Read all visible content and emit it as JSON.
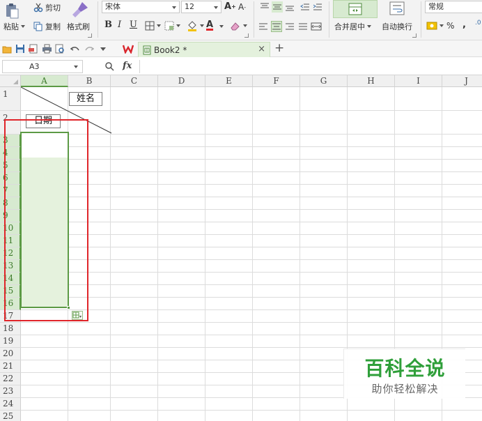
{
  "ribbon": {
    "clipboard": {
      "cut": "剪切",
      "paste": "粘贴",
      "copy": "复制",
      "format_painter": "格式刷"
    },
    "font": {
      "name": "宋体",
      "size": "12",
      "bold": "B",
      "italic": "I",
      "underline": "U",
      "grow": "A",
      "shrink": "A",
      "font_color_glyph": "A"
    },
    "alignment": {
      "merge_center": "合并居中",
      "wrap_text": "自动换行"
    },
    "number": {
      "format": "常规",
      "percent": "%",
      "comma": ","
    }
  },
  "quick_access": {
    "document_tab": "Book2 *",
    "tab_close": "×",
    "new_tab": "+"
  },
  "formula_bar": {
    "name_box": "A3",
    "fx_label": "fx",
    "formula_value": ""
  },
  "sheet": {
    "columns": [
      "A",
      "B",
      "C",
      "D",
      "E",
      "F",
      "G",
      "H",
      "I",
      "J"
    ],
    "rows": [
      "1",
      "2",
      "3",
      "4",
      "5",
      "6",
      "7",
      "8",
      "9",
      "10",
      "11",
      "12",
      "13",
      "14",
      "15",
      "16",
      "17",
      "18",
      "19",
      "20",
      "21",
      "22",
      "23",
      "24",
      "25"
    ],
    "selected_column": "A",
    "selected_range": "A3:A16",
    "cells": {
      "b1": "姓名",
      "a2": "日期"
    }
  },
  "watermark": {
    "title": "百科全说",
    "subtitle": "助你轻松解决"
  },
  "colors": {
    "selection_border": "#5c9a45",
    "selection_fill": "#e5f2dd",
    "highlight_box": "#e0252a",
    "watermark_green": "#2f9f3a"
  }
}
